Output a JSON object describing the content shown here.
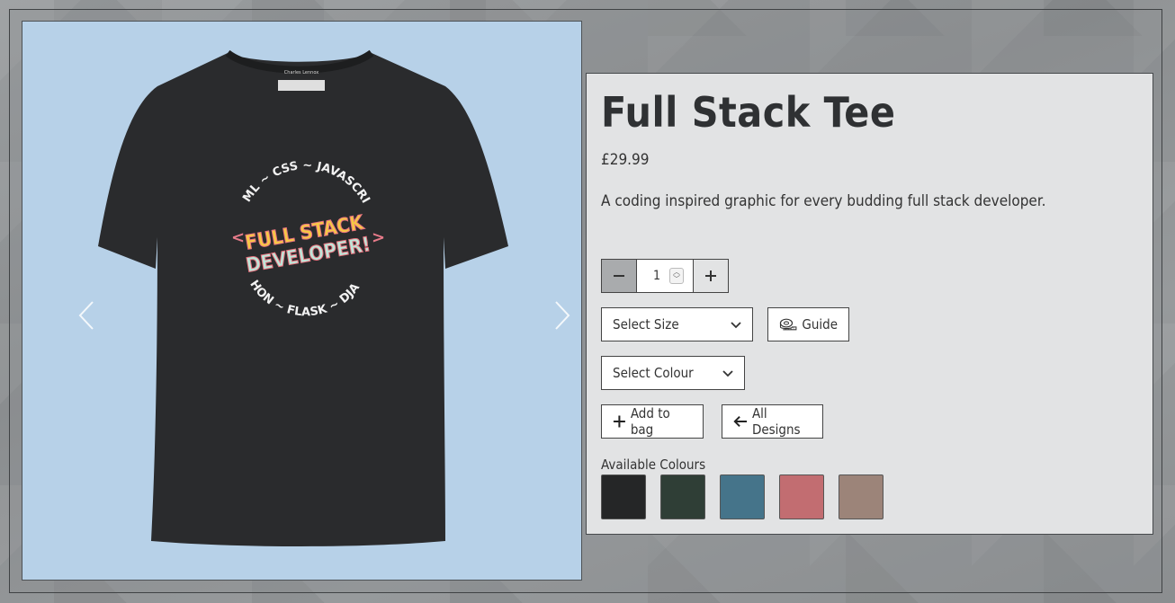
{
  "product": {
    "title": "Full Stack Tee",
    "price": "£29.99",
    "description": "A coding inspired graphic for every budding full stack developer."
  },
  "quantity": {
    "value": "1",
    "minus_icon": "minus-icon",
    "plus_icon": "plus-icon"
  },
  "size_select": {
    "selected": "Select Size"
  },
  "colour_select": {
    "selected": "Select Colour"
  },
  "buttons": {
    "guide": "Guide",
    "add_to_bag": "Add to bag",
    "all_designs": "All Designs"
  },
  "available_colours": {
    "label": "Available Colours",
    "swatches": [
      "#252627",
      "#2f3e36",
      "#45748a",
      "#c26d71",
      "#9c8479"
    ]
  },
  "shirt": {
    "brand_tag": "Charles Lennox",
    "top_arc": "HTML ~ CSS ~ JAVASCRIPT",
    "main_line1": "FULL STACK",
    "main_line2": "DEVELOPER!",
    "bottom_arc": "PYTHON ~ FLASK ~ DJANGO",
    "color": "#2a2b2d"
  },
  "carousel": {
    "prev_icon": "chevron-left-icon",
    "next_icon": "chevron-right-icon"
  }
}
